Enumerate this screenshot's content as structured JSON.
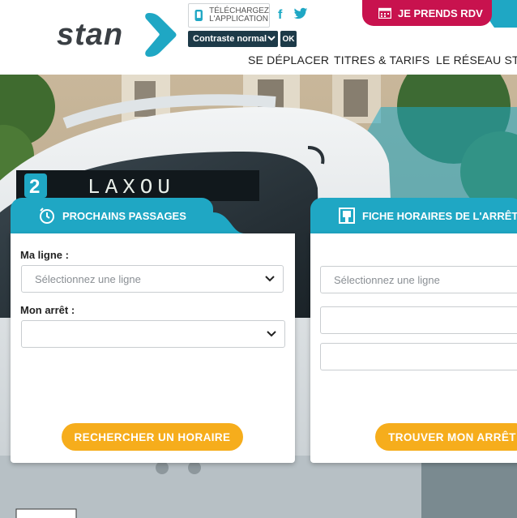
{
  "colors": {
    "brand_teal": "#1fa7c4",
    "brand_dark": "#3a3f44",
    "rdv_magenta": "#c8124e",
    "button_orange": "#f6ad1c",
    "contrast_bg": "#1d3a48"
  },
  "header": {
    "logo_text": "stan",
    "app_badge": {
      "line1": "TÉLÉCHARGEZ",
      "line2": "L'APPLICATION",
      "icon": "smartphone-icon"
    },
    "social": {
      "facebook": "f",
      "twitter_icon": "twitter-icon"
    },
    "contrast_select": {
      "value": "Contraste normal"
    },
    "ok_label": "OK",
    "rdv_button": {
      "label": "JE PRENDS RDV",
      "icon": "calendar-icon"
    }
  },
  "nav": {
    "items": [
      {
        "label": "SE DÉPLACER"
      },
      {
        "label": "TITRES & TARIFS"
      },
      {
        "label": "LE RÉSEAU STAN"
      }
    ]
  },
  "hero": {
    "bus_destination": "LAXOU",
    "bus_line_number": "2"
  },
  "panels": {
    "passages": {
      "title": "PROCHAINS PASSAGES",
      "icon": "clock-icon",
      "line_label": "Ma ligne :",
      "line_placeholder": "Sélectionnez une ligne",
      "stop_label": "Mon arrêt :",
      "stop_value": "",
      "button_label": "RECHERCHER UN HORAIRE"
    },
    "fiche": {
      "title": "FICHE HORAIRES DE L'ARRÊT",
      "icon": "bus-stop-icon",
      "line_placeholder": "Sélectionnez une ligne",
      "button_label": "TROUVER MON ARRÊT"
    }
  }
}
